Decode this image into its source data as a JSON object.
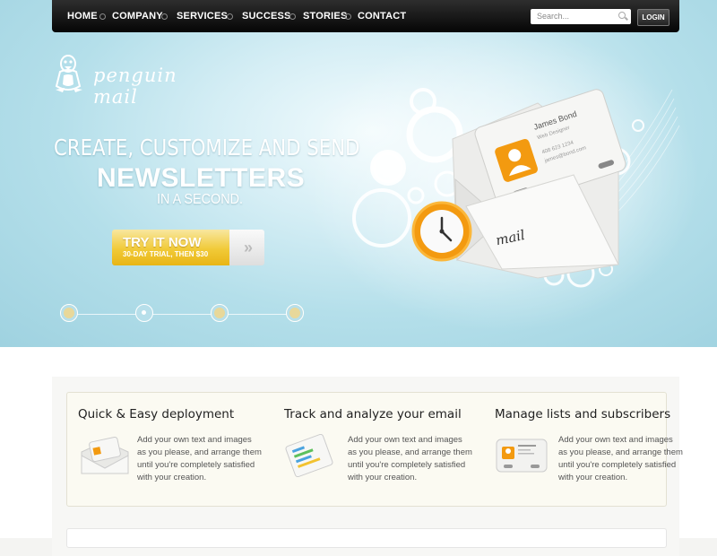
{
  "nav": {
    "items": [
      "HOME",
      "COMPANY",
      "SERVICES",
      "SUCCESS",
      "STORIES",
      "CONTACT"
    ],
    "search_placeholder": "Search...",
    "login_label": "LOGIN"
  },
  "logo": {
    "text": "penguin mail"
  },
  "hero": {
    "line1": "CREATE, CUSTOMIZE AND SEND",
    "line2": "NEWSLETTERS",
    "line3": "IN A SECOND.",
    "cta_label": "TRY IT NOW",
    "cta_sub": "30-DAY TRIAL, THEN $30",
    "cta_arrow": "»",
    "card_name": "James Bond",
    "card_title": "Web Designer",
    "card_phone": "408 623 1234",
    "card_email": "james@bond.com",
    "envelope_label": "mail",
    "slides": 4,
    "active_slide": 2
  },
  "features": [
    {
      "title": "Quick & Easy deployment",
      "text": "Add your own text and images as you please, and arrange them until you're completely satisfied with your creation.",
      "icon": "envelope-icon"
    },
    {
      "title": "Track and analyze your email",
      "text": "Add your own text and images as you please, and arrange them until you're completely satisfied with your creation.",
      "icon": "chart-icon"
    },
    {
      "title": "Manage lists and subscribers",
      "text": "Add your own text and images as you please, and arrange them until you're completely satisfied with your creation.",
      "icon": "contact-card-icon"
    }
  ],
  "colors": {
    "hero_bg": "#b4dfea",
    "cta_yellow": "#f1ca38",
    "nav_bg": "#111111",
    "accent_orange": "#f39a10"
  }
}
